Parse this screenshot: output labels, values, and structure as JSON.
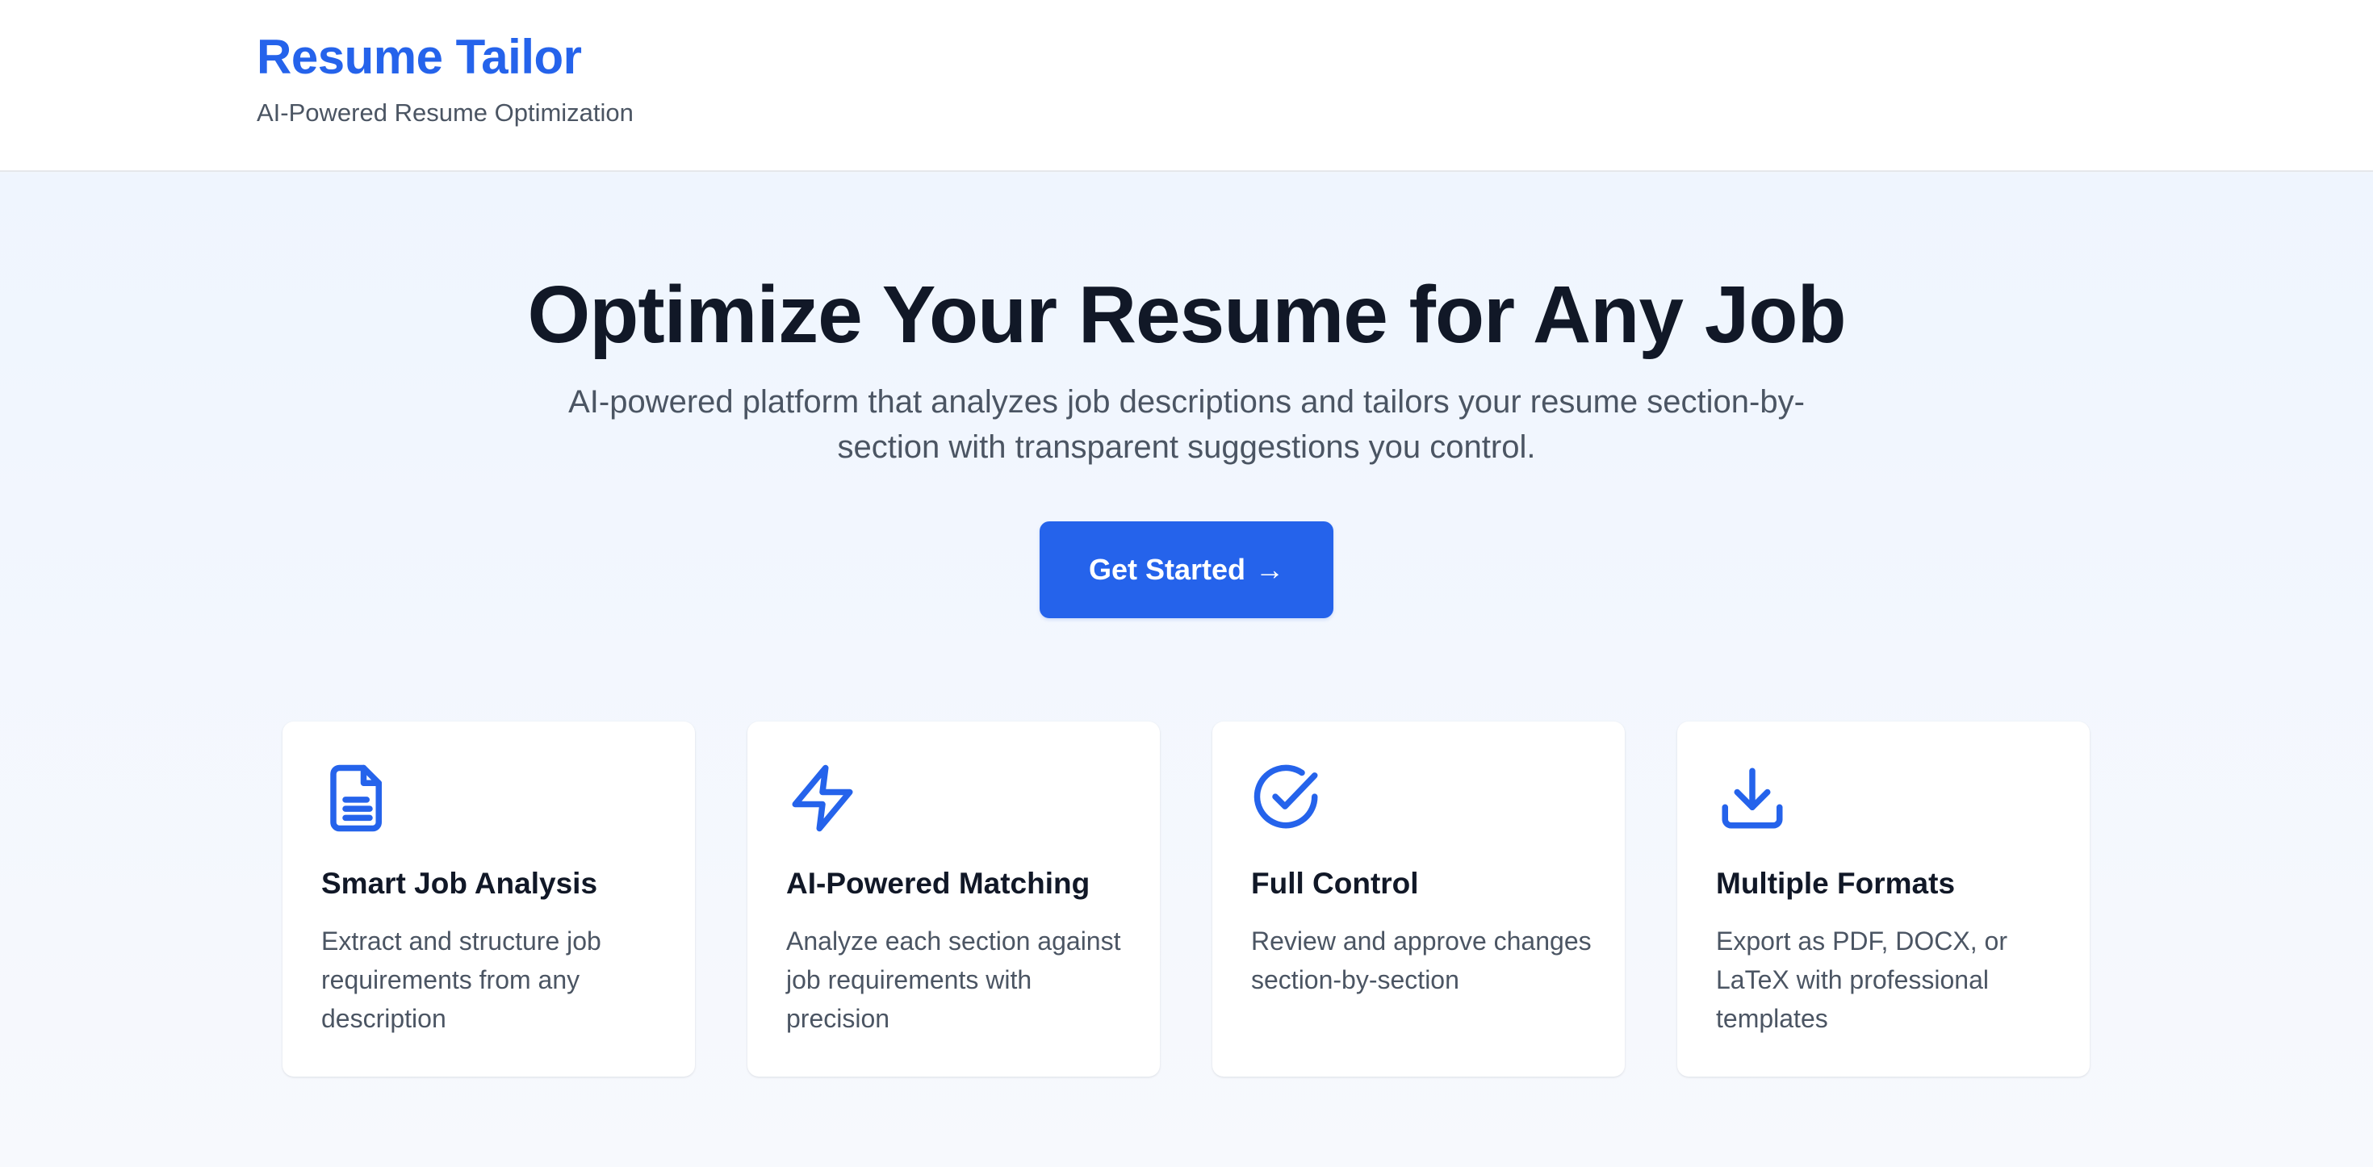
{
  "header": {
    "brand_title": "Resume Tailor",
    "brand_subtitle": "AI-Powered Resume Optimization"
  },
  "hero": {
    "title": "Optimize Your Resume for Any Job",
    "description": "AI-powered platform that analyzes job descriptions and tailors your resume section-by-section with transparent suggestions you control.",
    "cta_label": "Get Started",
    "cta_arrow": "→"
  },
  "features": [
    {
      "icon": "document-icon",
      "title": "Smart Job Analysis",
      "description": "Extract and structure job requirements from any description"
    },
    {
      "icon": "lightning-bolt-icon",
      "title": "AI-Powered Matching",
      "description": "Analyze each section against job requirements with precision"
    },
    {
      "icon": "check-circle-icon",
      "title": "Full Control",
      "description": "Review and approve changes section-by-section"
    },
    {
      "icon": "download-icon",
      "title": "Multiple Formats",
      "description": "Export as PDF, DOCX, or LaTeX with professional templates"
    }
  ],
  "colors": {
    "accent": "#2563eb",
    "heading": "#111827",
    "body_text": "#4b5563",
    "page_background": "#f1f6fd",
    "card_background": "#ffffff"
  }
}
